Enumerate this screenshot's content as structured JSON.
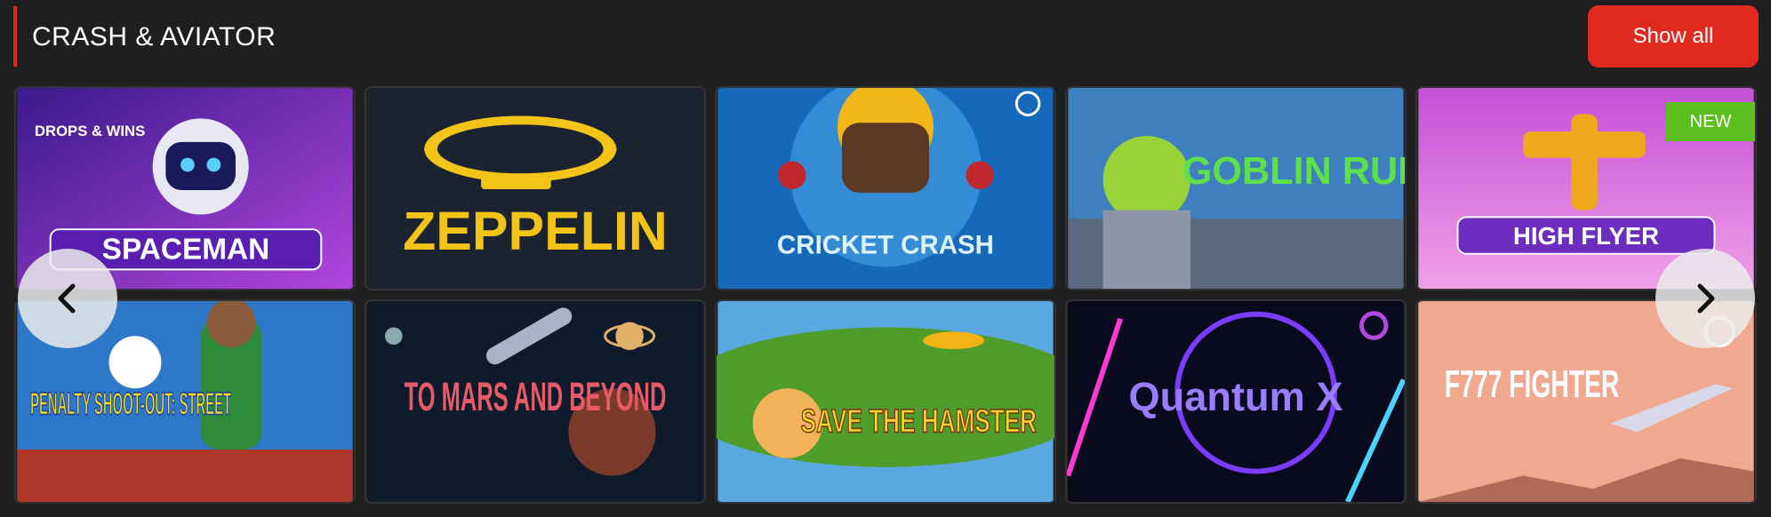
{
  "section": {
    "title": "CRASH & AVIATOR",
    "show_all_label": "Show all",
    "accent_color": "#e0291f"
  },
  "games": [
    {
      "name": "SPACEMAN",
      "extra_text": "DROPS & WINS"
    },
    {
      "name": "ZEPPELIN"
    },
    {
      "name": "CRICKET CRASH"
    },
    {
      "name": "GOBLIN RUN"
    },
    {
      "name": "HIGH FLYER",
      "badge": "NEW"
    },
    {
      "name": "PENALTY SHOOT-OUT: STREET"
    },
    {
      "name": "TO MARS AND BEYOND"
    },
    {
      "name": "SAVE THE HAMSTER"
    },
    {
      "name": "Quantum X"
    },
    {
      "name": "F777 FIGHTER"
    }
  ],
  "nav": {
    "prev_icon": "chevron-left-icon",
    "next_icon": "chevron-right-icon"
  }
}
